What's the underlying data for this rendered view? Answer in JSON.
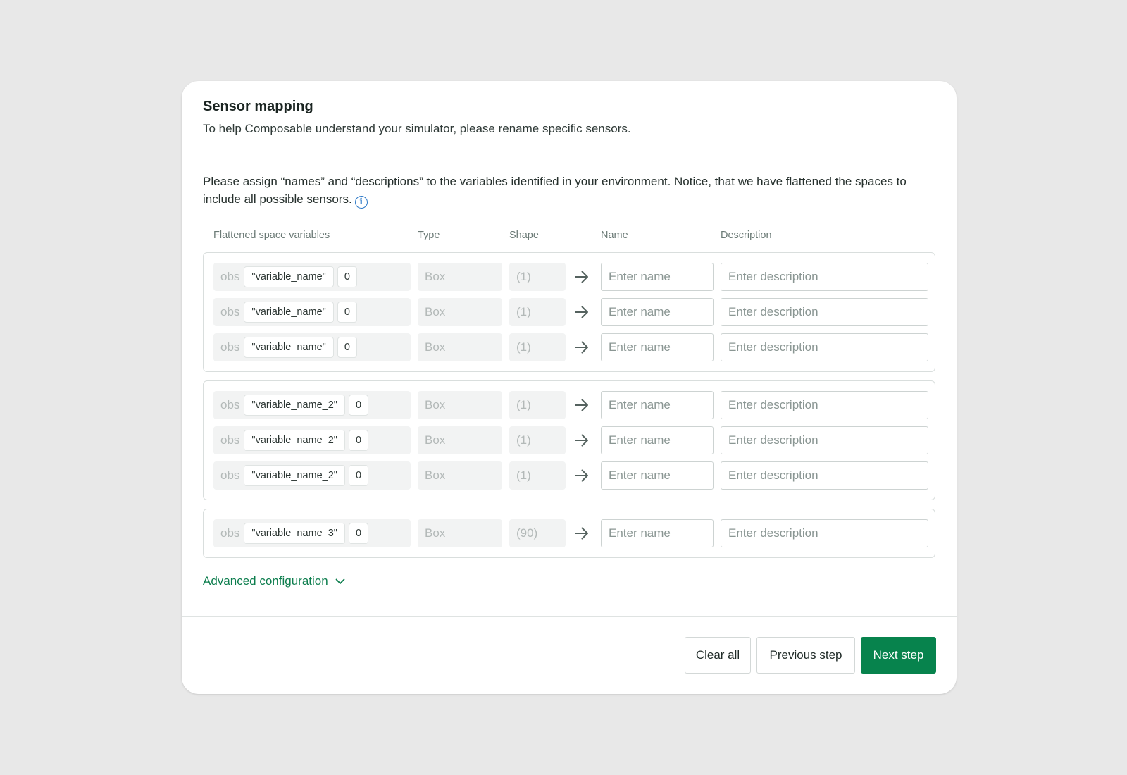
{
  "header": {
    "title": "Sensor mapping",
    "subtitle": "To help Composable understand your simulator, please rename specific sensors."
  },
  "intro": {
    "text": "Please assign “names” and “descriptions” to the variables identified in your environment. Notice, that we have flattened the spaces to include all possible sensors.",
    "info_icon": "info-icon"
  },
  "columns": {
    "variables": "Flattened space variables",
    "type": "Type",
    "shape": "Shape",
    "name": "Name",
    "description": "Description"
  },
  "groups": [
    {
      "rows": [
        {
          "prefix": "obs",
          "key": "\"variable_name\"",
          "index": "0",
          "type": "Box",
          "shape": "(1)",
          "name_placeholder": "Enter name",
          "desc_placeholder": "Enter description"
        },
        {
          "prefix": "obs",
          "key": "\"variable_name\"",
          "index": "0",
          "type": "Box",
          "shape": "(1)",
          "name_placeholder": "Enter name",
          "desc_placeholder": "Enter description"
        },
        {
          "prefix": "obs",
          "key": "\"variable_name\"",
          "index": "0",
          "type": "Box",
          "shape": "(1)",
          "name_placeholder": "Enter name",
          "desc_placeholder": "Enter description"
        }
      ]
    },
    {
      "rows": [
        {
          "prefix": "obs",
          "key": "\"variable_name_2\"",
          "index": "0",
          "type": "Box",
          "shape": "(1)",
          "name_placeholder": "Enter name",
          "desc_placeholder": "Enter description"
        },
        {
          "prefix": "obs",
          "key": "\"variable_name_2\"",
          "index": "0",
          "type": "Box",
          "shape": "(1)",
          "name_placeholder": "Enter name",
          "desc_placeholder": "Enter description"
        },
        {
          "prefix": "obs",
          "key": "\"variable_name_2\"",
          "index": "0",
          "type": "Box",
          "shape": "(1)",
          "name_placeholder": "Enter name",
          "desc_placeholder": "Enter description"
        }
      ]
    },
    {
      "rows": [
        {
          "prefix": "obs",
          "key": "\"variable_name_3\"",
          "index": "0",
          "type": "Box",
          "shape": "(90)",
          "name_placeholder": "Enter name",
          "desc_placeholder": "Enter description"
        }
      ]
    }
  ],
  "advanced": {
    "label": "Advanced configuration",
    "icon": "chevron-down-icon"
  },
  "footer": {
    "clear_label": "Clear all",
    "prev_label": "Previous step",
    "next_label": "Next step"
  },
  "colors": {
    "accent": "#07834d",
    "link": "#0c7d4d",
    "info": "#2d79c7"
  }
}
